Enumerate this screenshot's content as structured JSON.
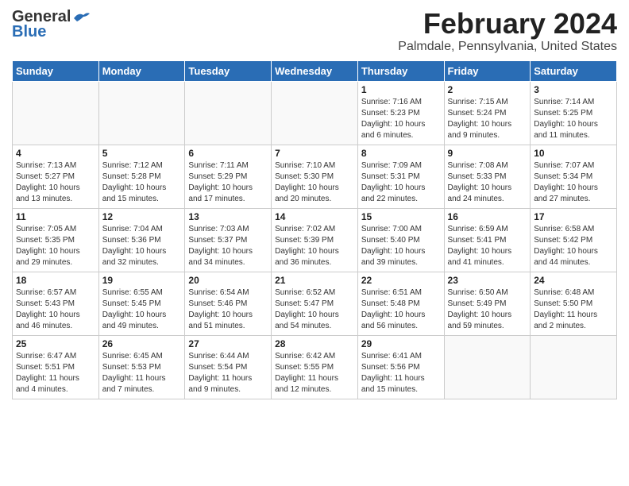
{
  "header": {
    "logo_general": "General",
    "logo_blue": "Blue",
    "month_title": "February 2024",
    "location": "Palmdale, Pennsylvania, United States"
  },
  "weekdays": [
    "Sunday",
    "Monday",
    "Tuesday",
    "Wednesday",
    "Thursday",
    "Friday",
    "Saturday"
  ],
  "weeks": [
    [
      {
        "day": "",
        "info": ""
      },
      {
        "day": "",
        "info": ""
      },
      {
        "day": "",
        "info": ""
      },
      {
        "day": "",
        "info": ""
      },
      {
        "day": "1",
        "info": "Sunrise: 7:16 AM\nSunset: 5:23 PM\nDaylight: 10 hours\nand 6 minutes."
      },
      {
        "day": "2",
        "info": "Sunrise: 7:15 AM\nSunset: 5:24 PM\nDaylight: 10 hours\nand 9 minutes."
      },
      {
        "day": "3",
        "info": "Sunrise: 7:14 AM\nSunset: 5:25 PM\nDaylight: 10 hours\nand 11 minutes."
      }
    ],
    [
      {
        "day": "4",
        "info": "Sunrise: 7:13 AM\nSunset: 5:27 PM\nDaylight: 10 hours\nand 13 minutes."
      },
      {
        "day": "5",
        "info": "Sunrise: 7:12 AM\nSunset: 5:28 PM\nDaylight: 10 hours\nand 15 minutes."
      },
      {
        "day": "6",
        "info": "Sunrise: 7:11 AM\nSunset: 5:29 PM\nDaylight: 10 hours\nand 17 minutes."
      },
      {
        "day": "7",
        "info": "Sunrise: 7:10 AM\nSunset: 5:30 PM\nDaylight: 10 hours\nand 20 minutes."
      },
      {
        "day": "8",
        "info": "Sunrise: 7:09 AM\nSunset: 5:31 PM\nDaylight: 10 hours\nand 22 minutes."
      },
      {
        "day": "9",
        "info": "Sunrise: 7:08 AM\nSunset: 5:33 PM\nDaylight: 10 hours\nand 24 minutes."
      },
      {
        "day": "10",
        "info": "Sunrise: 7:07 AM\nSunset: 5:34 PM\nDaylight: 10 hours\nand 27 minutes."
      }
    ],
    [
      {
        "day": "11",
        "info": "Sunrise: 7:05 AM\nSunset: 5:35 PM\nDaylight: 10 hours\nand 29 minutes."
      },
      {
        "day": "12",
        "info": "Sunrise: 7:04 AM\nSunset: 5:36 PM\nDaylight: 10 hours\nand 32 minutes."
      },
      {
        "day": "13",
        "info": "Sunrise: 7:03 AM\nSunset: 5:37 PM\nDaylight: 10 hours\nand 34 minutes."
      },
      {
        "day": "14",
        "info": "Sunrise: 7:02 AM\nSunset: 5:39 PM\nDaylight: 10 hours\nand 36 minutes."
      },
      {
        "day": "15",
        "info": "Sunrise: 7:00 AM\nSunset: 5:40 PM\nDaylight: 10 hours\nand 39 minutes."
      },
      {
        "day": "16",
        "info": "Sunrise: 6:59 AM\nSunset: 5:41 PM\nDaylight: 10 hours\nand 41 minutes."
      },
      {
        "day": "17",
        "info": "Sunrise: 6:58 AM\nSunset: 5:42 PM\nDaylight: 10 hours\nand 44 minutes."
      }
    ],
    [
      {
        "day": "18",
        "info": "Sunrise: 6:57 AM\nSunset: 5:43 PM\nDaylight: 10 hours\nand 46 minutes."
      },
      {
        "day": "19",
        "info": "Sunrise: 6:55 AM\nSunset: 5:45 PM\nDaylight: 10 hours\nand 49 minutes."
      },
      {
        "day": "20",
        "info": "Sunrise: 6:54 AM\nSunset: 5:46 PM\nDaylight: 10 hours\nand 51 minutes."
      },
      {
        "day": "21",
        "info": "Sunrise: 6:52 AM\nSunset: 5:47 PM\nDaylight: 10 hours\nand 54 minutes."
      },
      {
        "day": "22",
        "info": "Sunrise: 6:51 AM\nSunset: 5:48 PM\nDaylight: 10 hours\nand 56 minutes."
      },
      {
        "day": "23",
        "info": "Sunrise: 6:50 AM\nSunset: 5:49 PM\nDaylight: 10 hours\nand 59 minutes."
      },
      {
        "day": "24",
        "info": "Sunrise: 6:48 AM\nSunset: 5:50 PM\nDaylight: 11 hours\nand 2 minutes."
      }
    ],
    [
      {
        "day": "25",
        "info": "Sunrise: 6:47 AM\nSunset: 5:51 PM\nDaylight: 11 hours\nand 4 minutes."
      },
      {
        "day": "26",
        "info": "Sunrise: 6:45 AM\nSunset: 5:53 PM\nDaylight: 11 hours\nand 7 minutes."
      },
      {
        "day": "27",
        "info": "Sunrise: 6:44 AM\nSunset: 5:54 PM\nDaylight: 11 hours\nand 9 minutes."
      },
      {
        "day": "28",
        "info": "Sunrise: 6:42 AM\nSunset: 5:55 PM\nDaylight: 11 hours\nand 12 minutes."
      },
      {
        "day": "29",
        "info": "Sunrise: 6:41 AM\nSunset: 5:56 PM\nDaylight: 11 hours\nand 15 minutes."
      },
      {
        "day": "",
        "info": ""
      },
      {
        "day": "",
        "info": ""
      }
    ]
  ]
}
